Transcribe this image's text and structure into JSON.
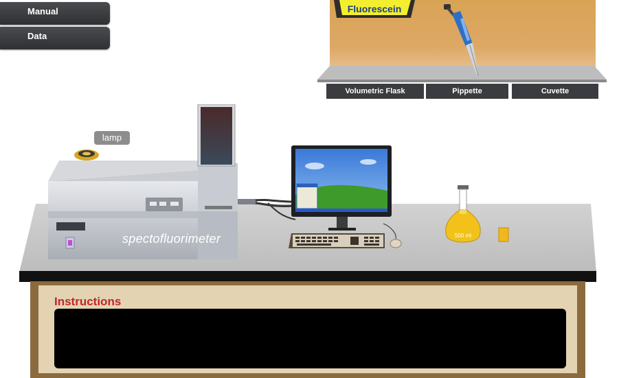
{
  "menu": {
    "manual_label": "Manual",
    "data_label": "Data"
  },
  "shelf": {
    "reagent_label": "Fluorescein",
    "tabs": [
      {
        "label": "Volumetric Flask"
      },
      {
        "label": "Pippette"
      },
      {
        "label": "Cuvette"
      }
    ]
  },
  "bench": {
    "lamp_label": "lamp",
    "instrument_label": "spectofluorimeter",
    "flask_volume_label": "500 ml"
  },
  "instructions": {
    "title": "Instructions",
    "text": ""
  },
  "colors": {
    "instruction_title": "#c0262b",
    "shelf_wall": "#d9a355",
    "table_top": "#c9c9c9",
    "table_base": "#8b6b3d",
    "flask_liquid": "#f2c21a"
  }
}
